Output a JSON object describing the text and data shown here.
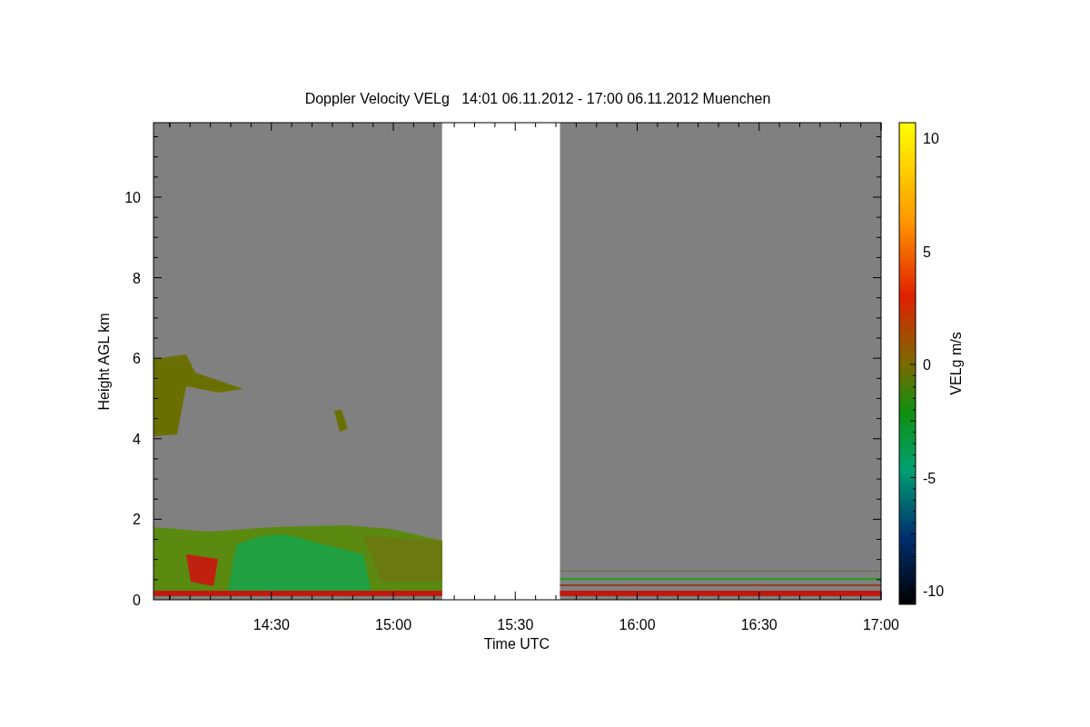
{
  "title": "Doppler Velocity VELg   14:01 06.11.2012 - 17:00 06.11.2012 Muenchen",
  "y_axis": {
    "label": "Height AGL km",
    "ticks": [
      "10",
      "8",
      "6",
      "4",
      "2",
      "0"
    ]
  },
  "x_axis": {
    "label": "Time UTC",
    "ticks": [
      "14:30",
      "15:00",
      "15:30",
      "16:00",
      "16:30",
      "17:00"
    ]
  },
  "colorbar": {
    "label": "VELg m/s",
    "ticks": [
      "10",
      "5",
      "0",
      "-5",
      "-10"
    ]
  }
}
